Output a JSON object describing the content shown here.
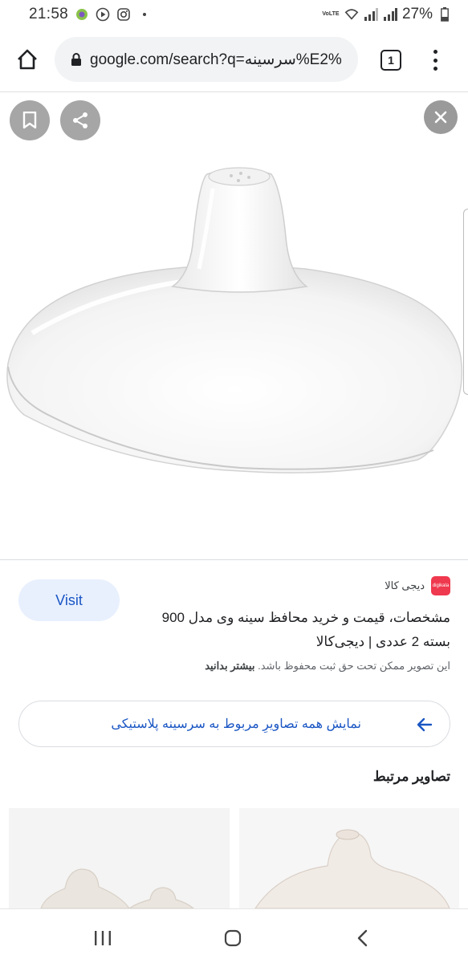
{
  "status_bar": {
    "time": "21:58",
    "network": "VoLTE",
    "battery": "27%"
  },
  "browser": {
    "url": "google.com/search?q=سرسینه%E2%",
    "tab_count": "1"
  },
  "result": {
    "visit_label": "Visit",
    "source_name": "دیجی کالا",
    "source_logo_text": "digikala",
    "title": "مشخصات، قیمت و خرید محافظ سینه وی مدل 900 بسته 2 عددی | دیجی‌کالا",
    "copyright_text": "این تصویر ممکن تحت حق ثبت محفوظ باشد.",
    "copyright_link": "بیشتر بدانید"
  },
  "related": {
    "show_all_label": "نمایش همه تصاویرِ مربوط به سرسینه پلاستیکی",
    "section_title": "تصاویر مرتبط"
  },
  "icons": {
    "bookmark": "bookmark-icon",
    "share": "share-icon",
    "close": "close-icon",
    "home": "home-icon",
    "lock": "lock-icon",
    "arrow": "arrow-left-icon"
  },
  "colors": {
    "accent": "#1a56c4",
    "visit_bg": "#e8f0fe",
    "source_brand": "#ef394e"
  }
}
